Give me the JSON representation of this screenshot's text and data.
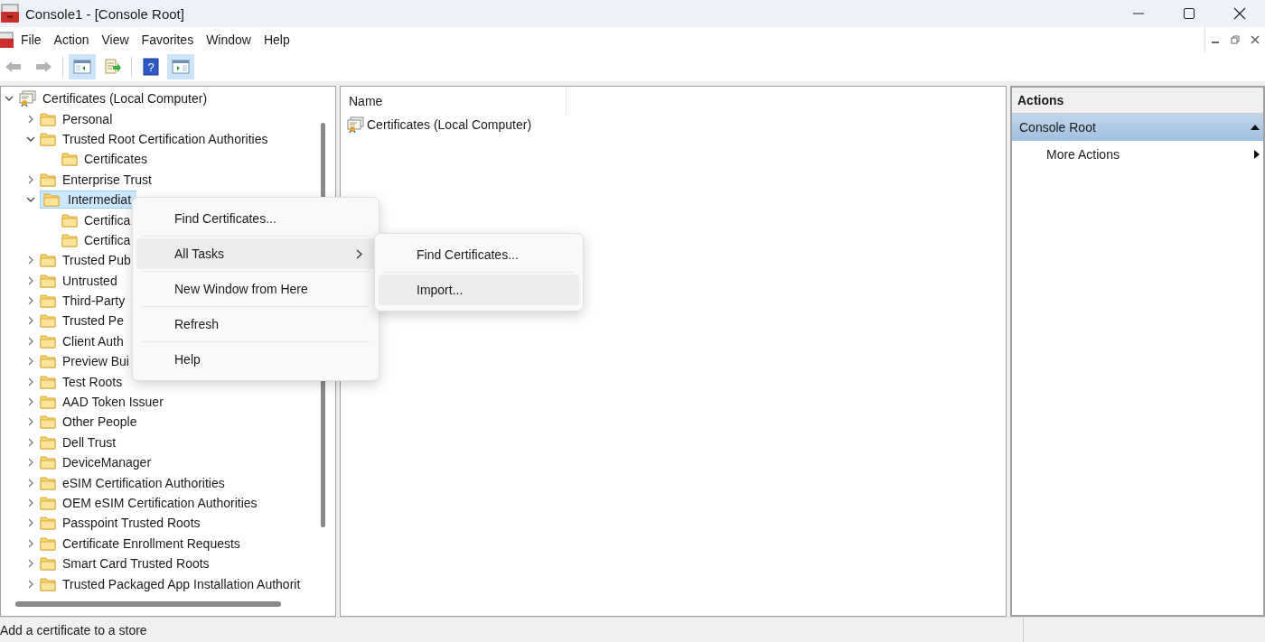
{
  "window": {
    "title": "Console1 - [Console Root]"
  },
  "menu_bar": {
    "items": [
      "File",
      "Action",
      "View",
      "Favorites",
      "Window",
      "Help"
    ]
  },
  "toolbar": {
    "buttons": [
      {
        "kind": "back",
        "disabled": true,
        "pressed": false
      },
      {
        "kind": "forward",
        "disabled": true,
        "pressed": false
      },
      {
        "kind": "separator"
      },
      {
        "kind": "console_tree",
        "disabled": false,
        "pressed": true
      },
      {
        "kind": "export",
        "disabled": false,
        "pressed": false
      },
      {
        "kind": "separator"
      },
      {
        "kind": "help",
        "glyph": "?",
        "disabled": false,
        "pressed": false
      },
      {
        "kind": "action_pane",
        "disabled": false,
        "pressed": true
      }
    ]
  },
  "tree": {
    "items": [
      {
        "label": "Certificates (Local Computer)",
        "kind": "store_root",
        "expanded": true,
        "selected": false,
        "children": [
          {
            "label": "Personal",
            "expanded": false,
            "selected": false
          },
          {
            "label": "Trusted Root Certification Authorities",
            "expanded": true,
            "selected": false,
            "children": [
              {
                "label": "Certificates",
                "selected": false
              }
            ]
          },
          {
            "label": "Enterprise Trust",
            "expanded": false,
            "selected": false
          },
          {
            "label": "Intermediat",
            "expanded": true,
            "selected": true,
            "children": [
              {
                "label": "Certifica",
                "selected": false
              },
              {
                "label": "Certifica",
                "selected": false
              }
            ]
          },
          {
            "label": "Trusted Pub",
            "expanded": false,
            "selected": false
          },
          {
            "label": "Untrusted",
            "expanded": false,
            "selected": false
          },
          {
            "label": "Third-Party",
            "expanded": false,
            "selected": false
          },
          {
            "label": "Trusted Pe",
            "expanded": false,
            "selected": false
          },
          {
            "label": "Client Auth",
            "expanded": false,
            "selected": false
          },
          {
            "label": "Preview Bui",
            "expanded": false,
            "selected": false
          },
          {
            "label": "Test Roots",
            "expanded": false,
            "selected": false
          },
          {
            "label": "AAD Token Issuer",
            "expanded": false,
            "selected": false
          },
          {
            "label": "Other People",
            "expanded": false,
            "selected": false
          },
          {
            "label": "Dell Trust",
            "expanded": false,
            "selected": false
          },
          {
            "label": "DeviceManager",
            "expanded": false,
            "selected": false
          },
          {
            "label": "eSIM Certification Authorities",
            "expanded": false,
            "selected": false
          },
          {
            "label": "OEM eSIM Certification Authorities",
            "expanded": false,
            "selected": false
          },
          {
            "label": "Passpoint Trusted Roots",
            "expanded": false,
            "selected": false
          },
          {
            "label": "Certificate Enrollment Requests",
            "expanded": false,
            "selected": false
          },
          {
            "label": "Smart Card Trusted Roots",
            "expanded": false,
            "selected": false
          },
          {
            "label": "Trusted Packaged App Installation Authorit",
            "expanded": false,
            "selected": false
          }
        ]
      }
    ]
  },
  "list_view": {
    "columns": [
      "Name"
    ],
    "rows": [
      "Certificates (Local Computer)"
    ]
  },
  "actions": {
    "title": "Actions",
    "section": {
      "label": "Console Root",
      "expanded": true,
      "items": [
        "More Actions"
      ]
    }
  },
  "context_menu": {
    "items": [
      {
        "label": "Find Certificates...",
        "kind": "item",
        "selected": false
      },
      {
        "label": "All Tasks",
        "kind": "submenu",
        "selected": true
      },
      {
        "label": "New Window from Here",
        "kind": "item",
        "selected": false
      },
      {
        "label": "Refresh",
        "kind": "item",
        "selected": false
      },
      {
        "label": "Help",
        "kind": "item",
        "selected": false
      }
    ],
    "submenu": {
      "items": [
        {
          "label": "Find Certificates...",
          "selected": false
        },
        {
          "label": "Import...",
          "selected": true
        }
      ]
    }
  },
  "status_bar": {
    "text": "Add a certificate to a store"
  }
}
